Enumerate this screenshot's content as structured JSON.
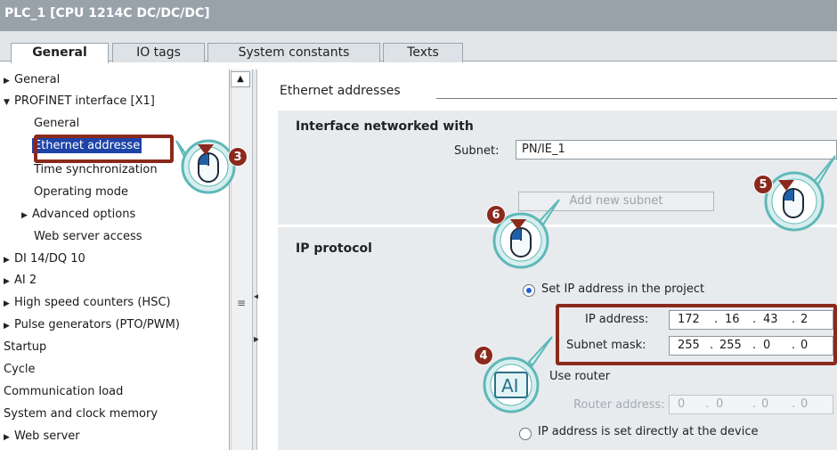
{
  "window": {
    "title": "PLC_1 [CPU 1214C DC/DC/DC]"
  },
  "tabs": [
    {
      "label": "General",
      "active": true
    },
    {
      "label": "IO tags"
    },
    {
      "label": "System constants"
    },
    {
      "label": "Texts"
    }
  ],
  "tree": [
    {
      "label": "General",
      "arrow": "▶",
      "indent": 0
    },
    {
      "label": "PROFINET interface [X1]",
      "arrow": "▼",
      "indent": 0
    },
    {
      "label": "General",
      "indent": 2
    },
    {
      "label": "Ethernet addresse",
      "indent": 2,
      "selected": true
    },
    {
      "label": "Time synchronization",
      "indent": 2
    },
    {
      "label": "Operating mode",
      "indent": 2
    },
    {
      "label": "Advanced options",
      "arrow": "▶",
      "indent": 1
    },
    {
      "label": "Web server access",
      "indent": 2
    },
    {
      "label": "DI 14/DQ 10",
      "arrow": "▶",
      "indent": 0
    },
    {
      "label": "AI 2",
      "arrow": "▶",
      "indent": 0
    },
    {
      "label": "High speed counters (HSC)",
      "arrow": "▶",
      "indent": 0
    },
    {
      "label": "Pulse generators (PTO/PWM)",
      "arrow": "▶",
      "indent": 0
    },
    {
      "label": "Startup",
      "indent": 0
    },
    {
      "label": "Cycle",
      "indent": 0
    },
    {
      "label": "Communication load",
      "indent": 0
    },
    {
      "label": "System and clock memory",
      "indent": 0
    },
    {
      "label": "Web server",
      "arrow": "▶",
      "indent": 0
    }
  ],
  "content": {
    "section_title": "Ethernet addresses",
    "interface_title": "Interface networked with",
    "subnet_label": "Subnet:",
    "subnet_value": "PN/IE_1",
    "add_subnet_label": "Add new subnet",
    "ip_protocol_title": "IP protocol",
    "radio_set_in_project": "Set IP address in the project",
    "ip_address_label": "IP address:",
    "ip_address": [
      "172",
      "16",
      "43",
      "2"
    ],
    "subnet_mask_label": "Subnet mask:",
    "subnet_mask": [
      "255",
      "255",
      "0",
      "0"
    ],
    "use_router_label": "Use router",
    "router_address_label": "Router address:",
    "router_address": [
      "0",
      "0",
      "0",
      "0"
    ],
    "radio_set_at_device": "IP address is set directly at the device"
  },
  "callouts": [
    {
      "number": "3",
      "icon": "mouse-icon"
    },
    {
      "number": "4",
      "icon": "text-input-icon",
      "glyph": "AI"
    },
    {
      "number": "5",
      "icon": "mouse-icon"
    },
    {
      "number": "6",
      "icon": "mouse-icon"
    }
  ],
  "colors": {
    "titlebar": "#99a2a9",
    "selection": "#1e44a8",
    "highlight": "#8b2a1c",
    "callout": "#5fb8b8"
  }
}
